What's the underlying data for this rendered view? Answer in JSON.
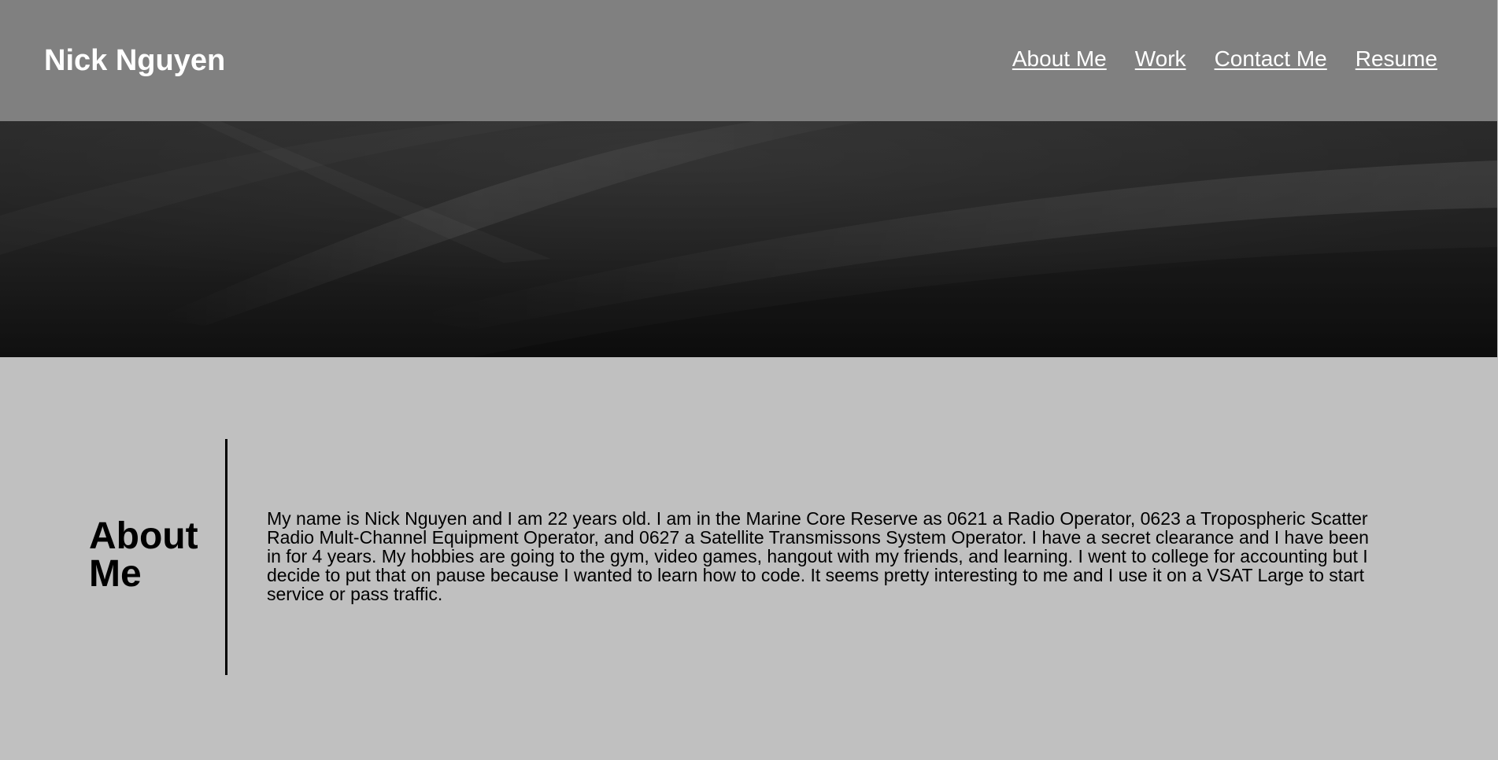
{
  "header": {
    "site_title": "Nick Nguyen",
    "nav": [
      {
        "label": "About Me"
      },
      {
        "label": "Work"
      },
      {
        "label": "Contact Me"
      },
      {
        "label": "Resume"
      }
    ]
  },
  "about": {
    "heading": "About Me",
    "body": "My name is Nick Nguyen and I am 22 years old. I am in the Marine Core Reserve as 0621 a Radio Operator, 0623 a Tropospheric Scatter Radio Mult-Channel Equipment Operator, and 0627 a Satellite Transmissons System Operator. I have a secret clearance and I have been in for 4 years. My hobbies are going to the gym, video games, hangout with my friends, and learning. I went to college for accounting but I decide to put that on pause because I wanted to learn how to code. It seems pretty interesting to me and I use it on a VSAT Large to start service or pass traffic."
  },
  "colors": {
    "header_bg": "#808080",
    "hero_bg": "#1f1f1f",
    "page_bg": "#c0c0c0",
    "text_light": "#ffffff",
    "text_dark": "#000000"
  }
}
